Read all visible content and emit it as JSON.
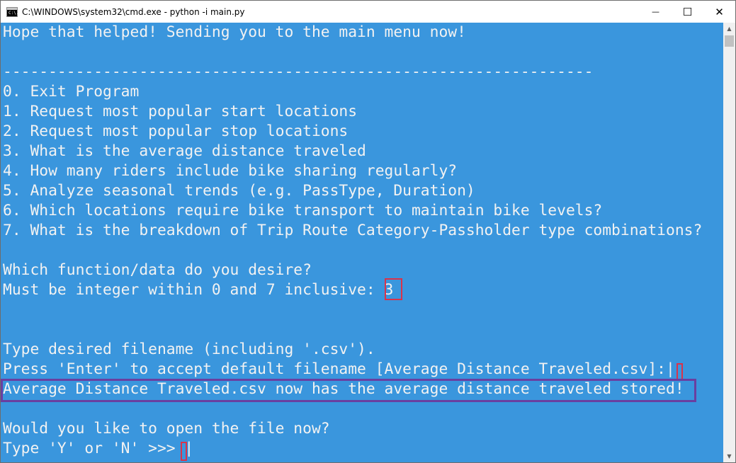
{
  "window": {
    "title": "C:\\WINDOWS\\system32\\cmd.exe - python  -i main.py",
    "icon": "cmd-icon",
    "icon_text": "C:\\.",
    "controls": {
      "minimize": "—",
      "maximize": "☐",
      "close": "✕"
    }
  },
  "console": {
    "lines": [
      "Hope that helped! Sending you to the main menu now!",
      "",
      "-----------------------------------------------------------------",
      "0. Exit Program",
      "1. Request most popular start locations",
      "2. Request most popular stop locations",
      "3. What is the average distance traveled",
      "4. How many riders include bike sharing regularly?",
      "5. Analyze seasonal trends (e.g. PassType, Duration)",
      "6. Which locations require bike transport to maintain bike levels?",
      "7. What is the breakdown of Trip Route Category-Passholder type combinations?",
      "",
      "Which function/data do you desire?",
      "Must be integer within 0 and 7 inclusive: 3",
      "",
      "",
      "Type desired filename (including '.csv').",
      "Press 'Enter' to accept default filename [Average Distance Traveled.csv]:|",
      "Average Distance Traveled.csv now has the average distance traveled stored!",
      "",
      "Would you like to open the file now?",
      "Type 'Y' or 'N' >>> |"
    ]
  },
  "colors": {
    "console_background": "#3a96dd",
    "console_text": "#f2f2f2",
    "highlight_red": "#d9334a",
    "highlight_purple": "#6a3fa0"
  },
  "scrollbar": {
    "up_arrow": "▲",
    "down_arrow": "▼"
  }
}
